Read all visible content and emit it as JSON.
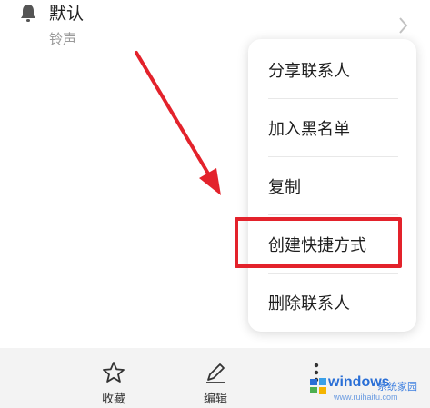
{
  "ringtone": {
    "title": "默认",
    "subtitle": "铃声"
  },
  "menu": {
    "items": [
      {
        "label": "分享联系人"
      },
      {
        "label": "加入黑名单"
      },
      {
        "label": "复制"
      },
      {
        "label": "创建快捷方式"
      },
      {
        "label": "删除联系人"
      }
    ],
    "highlighted_item": "创建快捷方式"
  },
  "bottom_bar": {
    "favorite_label": "收藏",
    "edit_label": "编辑"
  },
  "watermark": {
    "brand": "windows",
    "brand_suffix": "系统家园",
    "url": "www.ruihaitu.com"
  },
  "colors": {
    "annotation_red": "#e3222b",
    "bottom_bar_bg": "#f3f3f3",
    "subtext": "#9a9a9a"
  },
  "icons": [
    "bell-icon",
    "chevron-right-icon",
    "star-icon",
    "edit-pencil-icon",
    "more-vertical-icon",
    "windows-logo-icon"
  ]
}
